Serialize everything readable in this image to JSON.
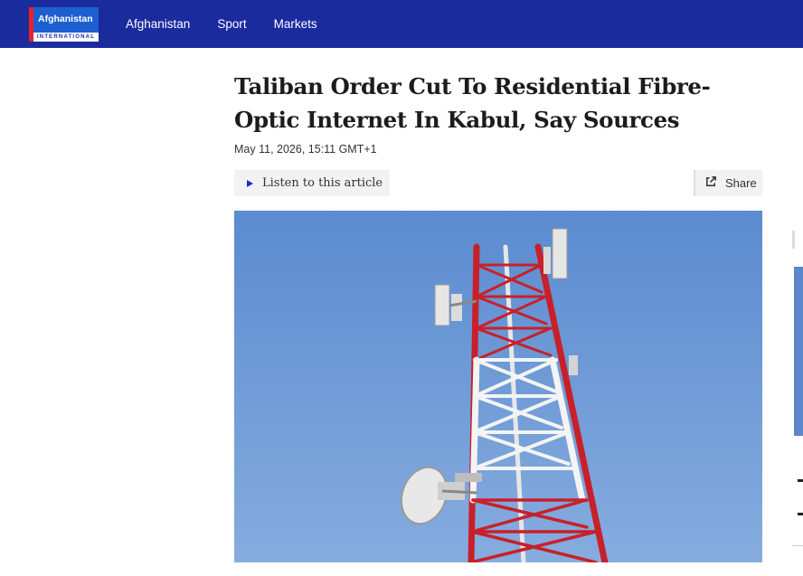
{
  "header": {
    "logo_main": "Afghanistan",
    "logo_sub": "INTERNATIONAL",
    "nav": [
      "Afghanistan",
      "Sport",
      "Markets"
    ]
  },
  "article": {
    "title": "Taliban Order Cut To Residential Fibre-Optic Internet In Kabul, Say Sources",
    "date": "May 11, 2026, 15:11 GMT+1",
    "listen_label": "Listen to this article",
    "share_label": "Share"
  },
  "colors": {
    "header_bg": "#1a2b9e",
    "logo_bg": "#1d5fd0",
    "logo_accent": "#e8212a",
    "sky": "#6e9ad6",
    "tower_red": "#c8202a",
    "tower_white": "#f2f2f2"
  },
  "icons": {
    "listen": "play-icon",
    "share": "share-icon"
  }
}
